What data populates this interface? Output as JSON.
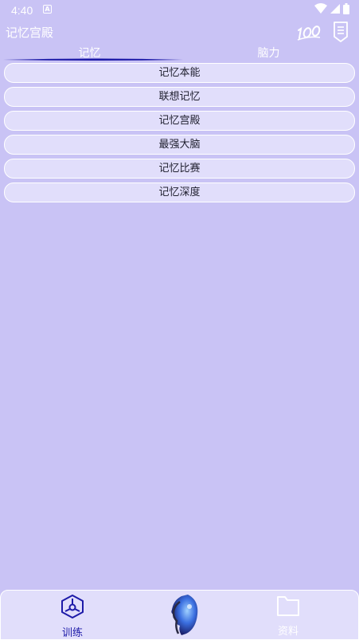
{
  "status_bar": {
    "time": "4:40",
    "notification_icon": "a-box-icon",
    "wifi_icon": "wifi-icon",
    "signal_icon": "cell-signal-icon",
    "battery_icon": "battery-icon"
  },
  "header": {
    "title": "记忆宫殿",
    "score_icon": "score-100-icon",
    "menu_icon": "document-list-icon"
  },
  "tabs": [
    {
      "label": "记忆",
      "selected": true
    },
    {
      "label": "脑力",
      "selected": false
    }
  ],
  "list": {
    "items": [
      {
        "label": "记忆本能"
      },
      {
        "label": "联想记忆"
      },
      {
        "label": "记忆宫殿"
      },
      {
        "label": "最强大脑"
      },
      {
        "label": "记忆比赛"
      },
      {
        "label": "记忆深度"
      }
    ]
  },
  "bottom_nav": {
    "train_label": "训练",
    "data_label": "资料",
    "active": "训练",
    "colors": {
      "active": "#1d1aa8",
      "inactive": "#ffffff"
    }
  },
  "colors": {
    "background": "#c9c3f5",
    "item_fill": "#e1defb",
    "accent": "#1d1aa8"
  }
}
